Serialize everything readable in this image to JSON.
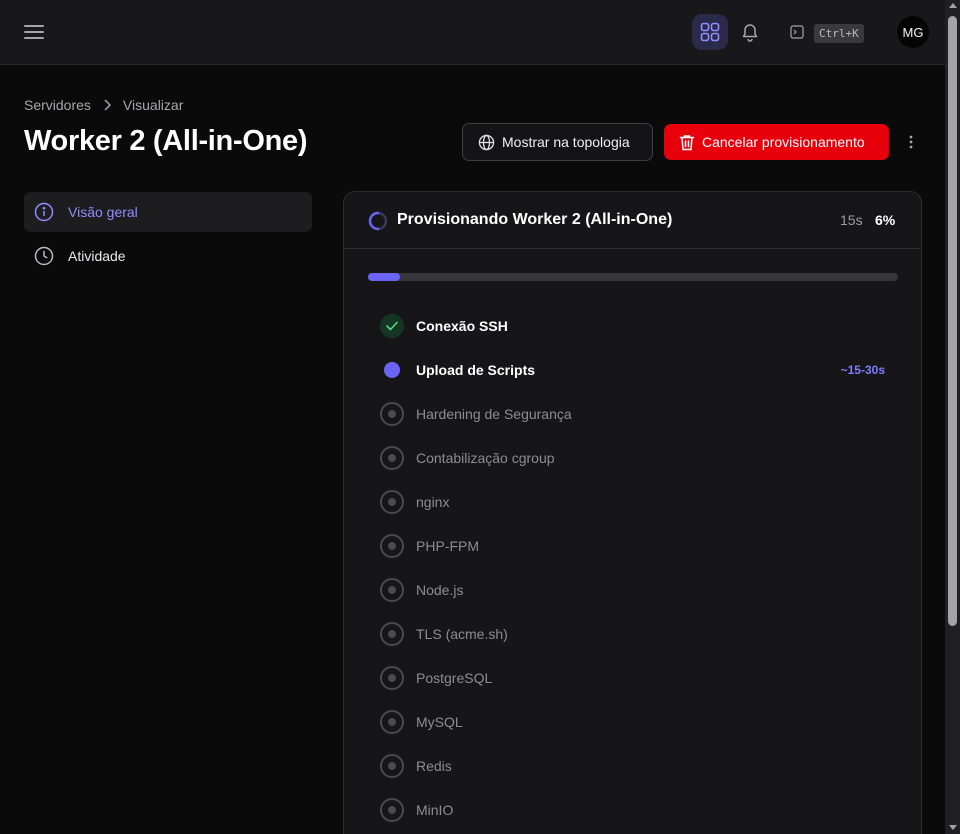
{
  "topbar": {
    "menu_icon": "hamburger-icon",
    "apps_icon": "grid-icon",
    "bell_icon": "bell-icon",
    "terminal_icon": "terminal-icon",
    "shortcut": "Ctrl+K",
    "avatar_initials": "MG",
    "accent_bg": "#2b2a4a"
  },
  "breadcrumb": {
    "items": [
      "Servidores",
      "Visualizar"
    ]
  },
  "page": {
    "title": "Worker 2 (All-in-One)"
  },
  "actions": {
    "topology_label": "Mostrar na topologia",
    "cancel_label": "Cancelar provisionamento",
    "cancel_color": "#e7000b"
  },
  "sidebar": {
    "items": [
      {
        "label": "Visão geral",
        "icon": "info-icon",
        "active": true
      },
      {
        "label": "Atividade",
        "icon": "clock-icon",
        "active": false
      }
    ]
  },
  "provisioning": {
    "title": "Provisionando Worker 2 (All-in-One)",
    "elapsed": "15s",
    "percent_label": "6%",
    "progress": 0.06,
    "accent_color": "#6a63f4",
    "steps": [
      {
        "label": "Conexão SSH",
        "status": "done"
      },
      {
        "label": "Upload de Scripts",
        "status": "active",
        "eta": "~15-30s"
      },
      {
        "label": "Hardening de Segurança",
        "status": "pending"
      },
      {
        "label": "Contabilização cgroup",
        "status": "pending"
      },
      {
        "label": "nginx",
        "status": "pending"
      },
      {
        "label": "PHP-FPM",
        "status": "pending"
      },
      {
        "label": "Node.js",
        "status": "pending"
      },
      {
        "label": "TLS (acme.sh)",
        "status": "pending"
      },
      {
        "label": "PostgreSQL",
        "status": "pending"
      },
      {
        "label": "MySQL",
        "status": "pending"
      },
      {
        "label": "Redis",
        "status": "pending"
      },
      {
        "label": "MinIO",
        "status": "pending"
      }
    ]
  }
}
